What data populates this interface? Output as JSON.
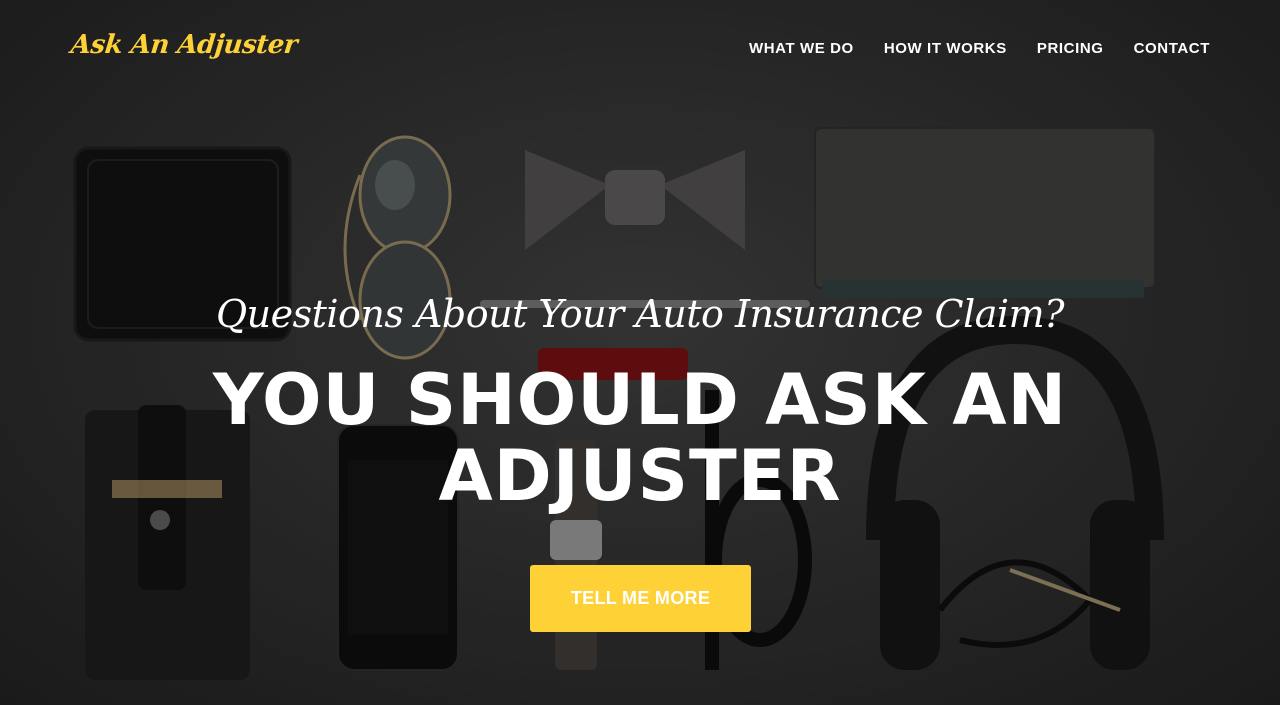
{
  "brand": {
    "name": "Ask An Adjuster",
    "color": "#fed136"
  },
  "nav": {
    "items": [
      {
        "label": "WHAT WE DO"
      },
      {
        "label": "HOW IT WORKS"
      },
      {
        "label": "PRICING"
      },
      {
        "label": "CONTACT"
      }
    ]
  },
  "hero": {
    "lead": "Questions About Your Auto Insurance Claim?",
    "heading": "YOU SHOULD ASK AN ADJUSTER",
    "cta_label": "TELL ME MORE",
    "accent_color": "#fed136",
    "background_icons": [
      "wallet-icon",
      "sunglasses-icon",
      "bow-tie-icon",
      "notebook-icon",
      "pen-icon",
      "pocket-knife-icon",
      "headphones-icon",
      "phone-sleeve-icon",
      "smartphone-icon",
      "watch-icon",
      "eyeglasses-icon"
    ]
  }
}
